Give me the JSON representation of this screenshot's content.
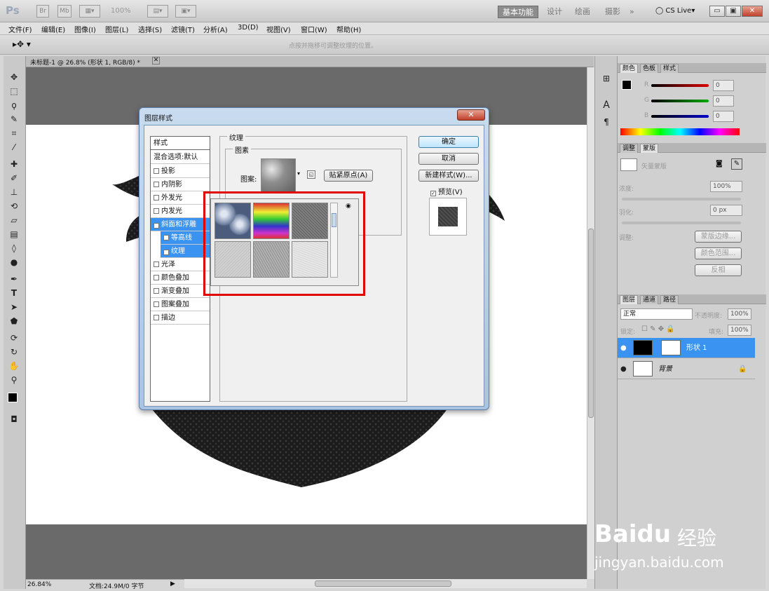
{
  "app": {
    "logo": "Ps",
    "zoom": "100%",
    "workspaces": [
      "基本功能",
      "设计",
      "绘画",
      "摄影"
    ],
    "more": "»",
    "cslive": "CS Live"
  },
  "menu": [
    "文件(F)",
    "编辑(E)",
    "图像(I)",
    "图层(L)",
    "选择(S)",
    "滤镜(T)",
    "分析(A)",
    "3D(D)",
    "视图(V)",
    "窗口(W)",
    "帮助(H)"
  ],
  "options": {
    "hint": "点按并拖移可调整纹理的位置。"
  },
  "document": {
    "tab_title": "未标题-1 @ 26.8% (形状 1, RGB/8) *",
    "status_zoom": "26.84%",
    "status_doc": "文档:24.9M/0 字节"
  },
  "dialog": {
    "title": "图层样式",
    "styles_header": "样式",
    "blend_options": "混合选项:默认",
    "styles": [
      {
        "label": "投影",
        "checked": false,
        "selected": false,
        "indent": false
      },
      {
        "label": "内阴影",
        "checked": false,
        "selected": false,
        "indent": false
      },
      {
        "label": "外发光",
        "checked": false,
        "selected": false,
        "indent": false
      },
      {
        "label": "内发光",
        "checked": false,
        "selected": false,
        "indent": false
      },
      {
        "label": "斜面和浮雕",
        "checked": true,
        "selected": true,
        "indent": false
      },
      {
        "label": "等高线",
        "checked": false,
        "selected": true,
        "indent": true
      },
      {
        "label": "纹理",
        "checked": true,
        "selected": true,
        "indent": true
      },
      {
        "label": "光泽",
        "checked": false,
        "selected": false,
        "indent": false
      },
      {
        "label": "颜色叠加",
        "checked": false,
        "selected": false,
        "indent": false
      },
      {
        "label": "渐变叠加",
        "checked": false,
        "selected": false,
        "indent": false
      },
      {
        "label": "图案叠加",
        "checked": false,
        "selected": false,
        "indent": false
      },
      {
        "label": "描边",
        "checked": false,
        "selected": false,
        "indent": false
      }
    ],
    "texture_title": "纹理",
    "pattern_group": "图素",
    "pattern_label": "图案:",
    "snap_button": "贴紧原点(A)",
    "ok": "确定",
    "cancel": "取消",
    "new_style": "新建样式(W)...",
    "preview_label": "预览(V)",
    "preview_checked": true
  },
  "patterns": [
    "bubbles",
    "rainbow",
    "noise-dark",
    "gray-fine",
    "gray-coarse",
    "gray-light"
  ],
  "panels": {
    "color_tabs": [
      "颜色",
      "色板",
      "样式"
    ],
    "rgb": [
      {
        "ch": "R",
        "value": "0"
      },
      {
        "ch": "G",
        "value": "0"
      },
      {
        "ch": "B",
        "value": "0"
      }
    ],
    "adjust_tabs": [
      "调整",
      "蒙版"
    ],
    "mask_title": "矢量蒙版",
    "density_label": "浓度:",
    "density_value": "100%",
    "feather_label": "羽化:",
    "feather_value": "0 px",
    "refine_label": "调整:",
    "mask_edge": "蒙版边缘...",
    "color_range": "颜色范围...",
    "invert": "反相",
    "layers_tabs": [
      "图层",
      "通道",
      "路径"
    ],
    "blend_mode": "正常",
    "opacity_label": "不透明度:",
    "opacity_value": "100%",
    "lock_label": "锁定:",
    "fill_label": "填充:",
    "fill_value": "100%",
    "layers": [
      {
        "name": "形状 1",
        "selected": true
      },
      {
        "name": "背景",
        "selected": false
      }
    ]
  },
  "watermark": {
    "brand": "Baidu",
    "product": "经验",
    "url": "jingyan.baidu.com"
  },
  "colors": {
    "accent": "#3a93f0",
    "highlight_box": "#e00000"
  }
}
